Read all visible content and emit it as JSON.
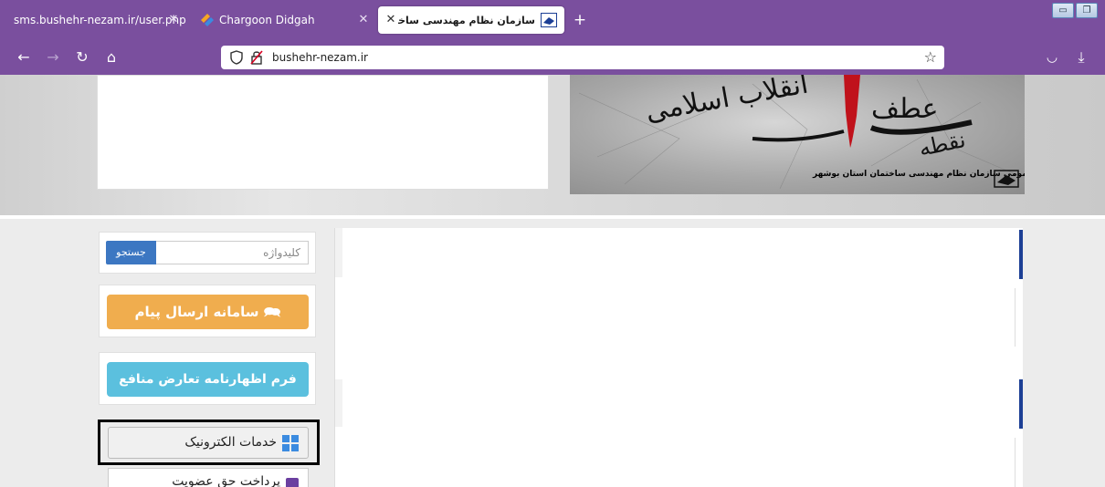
{
  "browser": {
    "tabs": [
      {
        "title": "sms.bushehr-nezam.ir/user.php",
        "active": false
      },
      {
        "title": "Chargoon Didgah",
        "active": false
      },
      {
        "title": "سازمان نظام مهندسی ساختمان است",
        "active": true
      }
    ],
    "new_tab_label": "+",
    "address": "bushehr-nezam.ir",
    "accent_color": "#7a4f9e"
  },
  "page": {
    "banner": {
      "headline_main": "عطف",
      "headline_sub": "انقلاب اسلامی",
      "headline_prefix": "نقطه",
      "caption": "روابط عمومی سازمان نظام مهندسی ساختمان استان بوشهر"
    },
    "sidebar": {
      "search_placeholder": "کلیدواژه",
      "search_button": "جستجو",
      "sms_button": "سامانه ارسال پیام",
      "form_button": "فرم اظهارنامه تعارض منافع",
      "services_label": "خدمات الکترونیک",
      "payment_label": "پرداخت حق عضویت"
    },
    "colors": {
      "sms_button": "#f0ad4e",
      "form_button": "#5bc0de",
      "search_button": "#3c77c2",
      "content_accent": "#1c3f95"
    }
  }
}
